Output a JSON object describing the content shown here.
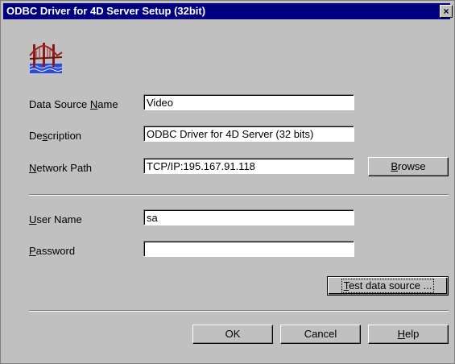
{
  "window": {
    "title": "ODBC Driver for 4D Server Setup (32bit)",
    "close_glyph": "×"
  },
  "icon": {
    "name": "odbc-bridge-icon"
  },
  "form": {
    "data_source_name": {
      "label_pre": "Data Source ",
      "label_key": "N",
      "label_post": "ame",
      "value": "Video"
    },
    "description": {
      "label_pre": "De",
      "label_key": "s",
      "label_post": "cription",
      "value": "ODBC Driver for 4D Server (32 bits)"
    },
    "network_path": {
      "label_pre": "",
      "label_key": "N",
      "label_post": "etwork Path",
      "value": "TCP/IP:195.167.91.118"
    },
    "user_name": {
      "label_pre": "",
      "label_key": "U",
      "label_post": "ser Name",
      "value": "sa"
    },
    "password": {
      "label_pre": "",
      "label_key": "P",
      "label_post": "assword",
      "value": ""
    }
  },
  "buttons": {
    "browse": {
      "key": "B",
      "rest": "rowse"
    },
    "test": {
      "key": "T",
      "rest": "est data source ..."
    },
    "ok": "OK",
    "cancel": "Cancel",
    "help": {
      "key": "H",
      "rest": "elp"
    }
  }
}
